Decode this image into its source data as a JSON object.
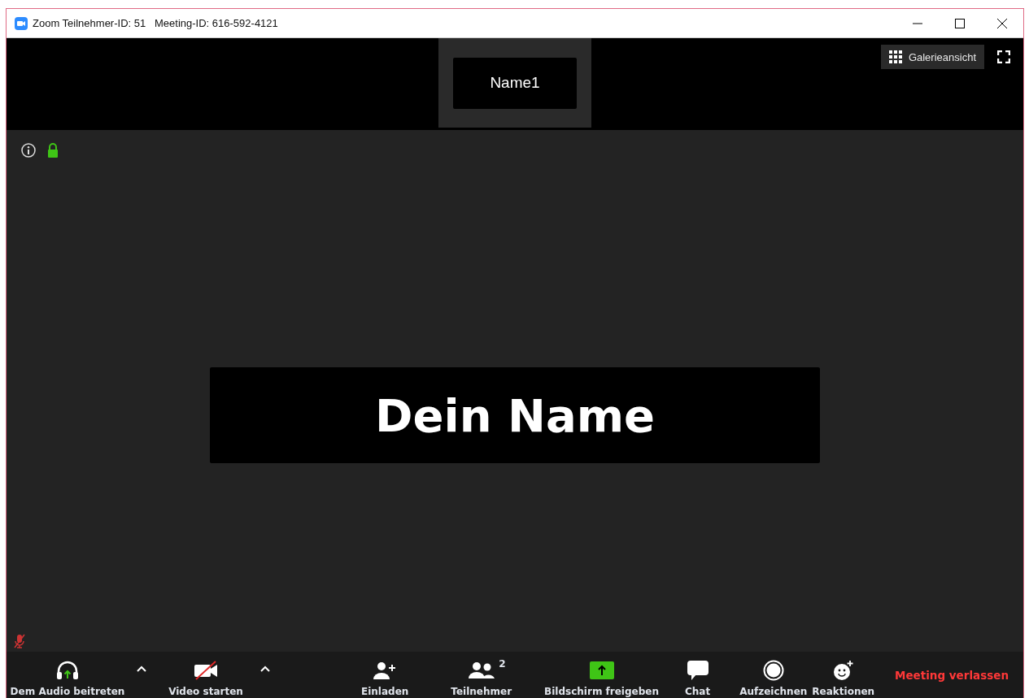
{
  "window": {
    "title": "Zoom Teilnehmer-ID: 51   Meeting-ID: 616-592-4121"
  },
  "view_button": {
    "label": "Galerieansicht"
  },
  "thumbnail": {
    "name": "Name1"
  },
  "main_video": {
    "name": "Dein Name"
  },
  "toolbar": [
    {
      "kind": "button",
      "label": "Dem Audio beitreten"
    },
    {
      "kind": "caret"
    },
    {
      "kind": "button",
      "label": "Video starten"
    },
    {
      "kind": "caret"
    },
    {
      "kind": "button",
      "label": "Einladen"
    },
    {
      "kind": "button",
      "label": "Teilnehmer",
      "badge": "2"
    },
    {
      "kind": "button",
      "label": "Bildschirm freigeben"
    },
    {
      "kind": "button",
      "label": "Chat"
    },
    {
      "kind": "button",
      "label": "Aufzeichnen"
    },
    {
      "kind": "button",
      "label": "Reaktionen"
    },
    {
      "kind": "leave",
      "label": "Meeting verlassen"
    }
  ]
}
